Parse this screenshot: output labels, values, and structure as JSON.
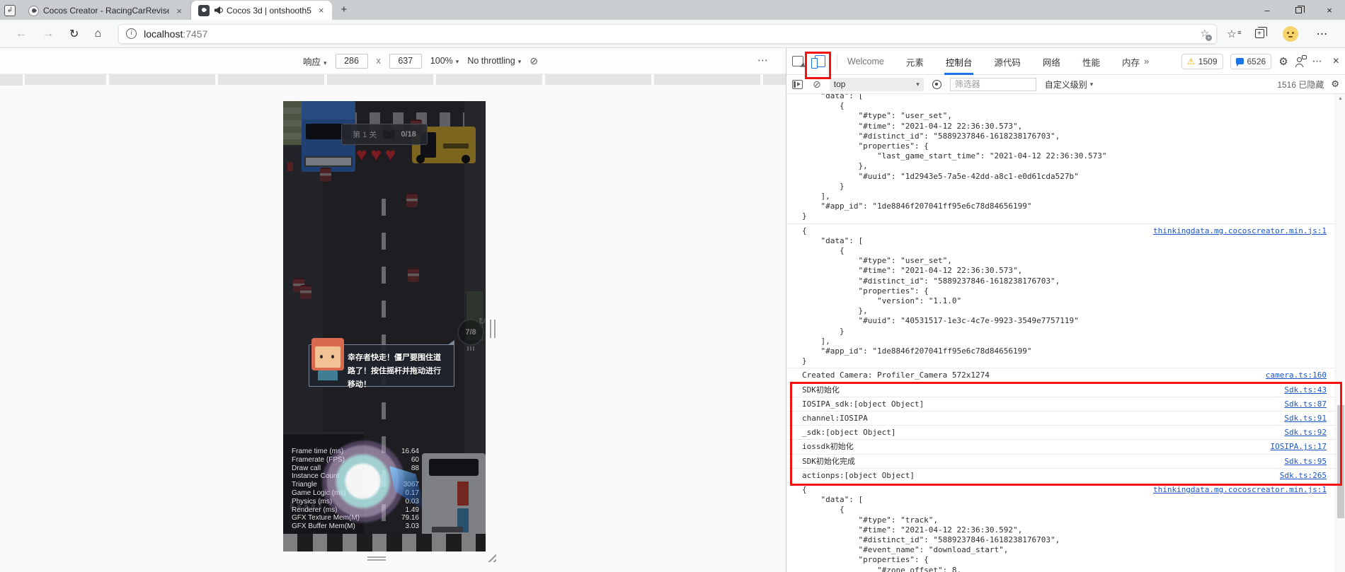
{
  "colors": {
    "accent_blue": "#1a73e8",
    "link_blue": "#1d56c9",
    "annotation_red": "#f11212",
    "heart_red": "#bf2730"
  },
  "icons": {
    "back": "←",
    "forward": "→",
    "refresh": "↻",
    "home": "⌂",
    "info": "i",
    "caret": "▾",
    "more": "⋯",
    "close": "×",
    "plus": "+",
    "block": "⊘",
    "star": "☆",
    "warning": "⚠",
    "gear": "⚙",
    "up_arrow": "▲",
    "loop": "↻",
    "heart": "♥",
    "tab_arrow": "↲",
    "minimize": "–",
    "more_tabs": "»"
  },
  "window": {
    "tabs": [
      {
        "title": "Cocos Creator - RacingCarRevise"
      },
      {
        "title": "Cocos 3d | ontshooth5"
      }
    ],
    "new_tab": "+"
  },
  "navbar": {
    "url_host": "localhost",
    "url_port": ":7457"
  },
  "device_toolbar": {
    "mode": "响应",
    "dim_w": "286",
    "dim_sep": "x",
    "dim_h": "637",
    "zoom": "100%",
    "throttling": "No throttling"
  },
  "game": {
    "hud": {
      "level": "第 1 关",
      "progress": "0/18",
      "hearts": 3,
      "wave": "7/8"
    },
    "dialog": "幸存者快走！僵尸要围住道路了！按住摇杆并拖动进行移动！",
    "stats": [
      {
        "label": "Frame time (ms)",
        "value": "16.64"
      },
      {
        "label": "Framerate (FPS)",
        "value": "60"
      },
      {
        "label": "Draw call",
        "value": "88"
      },
      {
        "label": "Instance Count",
        "value": ""
      },
      {
        "label": "Triangle",
        "value": "3067"
      },
      {
        "label": "Game Logic (ms)",
        "value": "0.17"
      },
      {
        "label": "Physics (ms)",
        "value": "0.03"
      },
      {
        "label": "Renderer (ms)",
        "value": "1.49"
      },
      {
        "label": "GFX Texture Mem(M)",
        "value": "79.16"
      },
      {
        "label": "GFX Buffer Mem(M)",
        "value": "3.03"
      }
    ]
  },
  "devtools": {
    "tabs": [
      {
        "label": "Welcome",
        "dim": true
      },
      {
        "label": "元素"
      },
      {
        "label": "控制台",
        "active": true
      },
      {
        "label": "源代码"
      },
      {
        "label": "网络"
      },
      {
        "label": "性能"
      },
      {
        "label": "内存"
      }
    ],
    "badges": {
      "warnings": "1509",
      "messages": "6526"
    },
    "console_toolbar": {
      "context": "top",
      "filter_placeholder": "筛选器",
      "level_label": "自定义级别",
      "hidden_count": "1516 已隐藏"
    },
    "console": {
      "messages": [
        {
          "kind": "json",
          "link": "",
          "text": "    \"data\": [\n        {\n            \"#type\": \"user_set\",\n            \"#time\": \"2021-04-12 22:36:30.573\",\n            \"#distinct_id\": \"5889237846-1618238176703\",\n            \"properties\": {\n                \"last_game_start_time\": \"2021-04-12 22:36:30.573\"\n            },\n            \"#uuid\": \"1d2943e5-7a5e-42dd-a8c1-e0d61cda527b\"\n        }\n    ],\n    \"#app_id\": \"1de8846f207041ff95e6c78d84656199\"\n}"
        },
        {
          "kind": "json",
          "link": "thinkingdata.mg.cocoscreator.min.js:1",
          "text": "{\n    \"data\": [\n        {\n            \"#type\": \"user_set\",\n            \"#time\": \"2021-04-12 22:36:30.573\",\n            \"#distinct_id\": \"5889237846-1618238176703\",\n            \"properties\": {\n                \"version\": \"1.1.0\"\n            },\n            \"#uuid\": \"40531517-1e3c-4c7e-9923-3549e7757119\"\n        }\n    ],\n    \"#app_id\": \"1de8846f207041ff95e6c78d84656199\"\n}"
        },
        {
          "kind": "log",
          "text": "Created Camera: Profiler_Camera 572x1274",
          "link": "camera.ts:160"
        },
        {
          "kind": "log",
          "text": "SDK初始化",
          "link": "Sdk.ts:43"
        },
        {
          "kind": "log",
          "text": "IOSIPA_sdk:[object Object]",
          "link": "Sdk.ts:87"
        },
        {
          "kind": "log",
          "text": "channel:IOSIPA",
          "link": "Sdk.ts:91"
        },
        {
          "kind": "log",
          "text": "_sdk:[object Object]",
          "link": "Sdk.ts:92"
        },
        {
          "kind": "log",
          "text": "iossdk初始化",
          "link": "IOSIPA.js:17"
        },
        {
          "kind": "log",
          "text": "SDK初始化完成",
          "link": "Sdk.ts:95"
        },
        {
          "kind": "log",
          "text": "actionps:[object Object]",
          "link": "Sdk.ts:265"
        },
        {
          "kind": "json",
          "link": "thinkingdata.mg.cocoscreator.min.js:1",
          "text": "{\n    \"data\": [\n        {\n            \"#type\": \"track\",\n            \"#time\": \"2021-04-12 22:36:30.592\",\n            \"#distinct_id\": \"5889237846-1618238176703\",\n            \"#event_name\": \"download_start\",\n            \"properties\": {\n                \"#zone_offset\": 8,"
        }
      ]
    }
  }
}
